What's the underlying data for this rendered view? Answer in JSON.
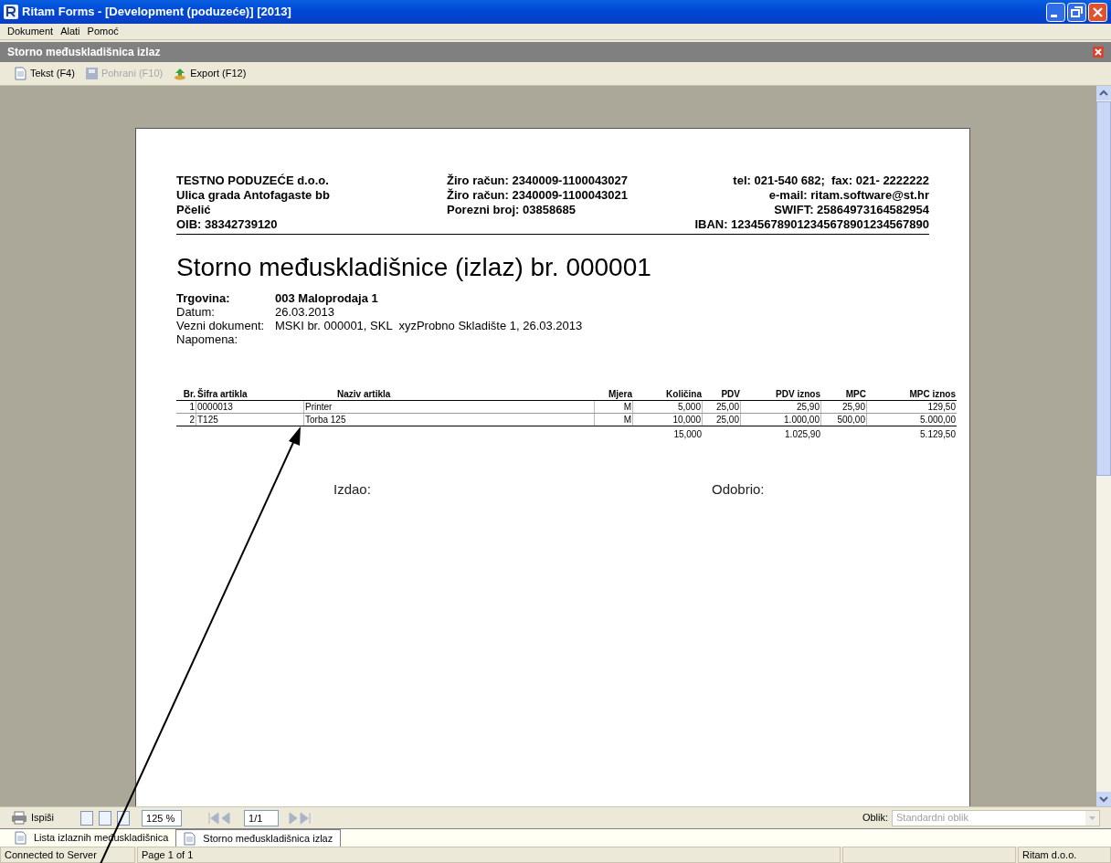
{
  "window": {
    "title": "Ritam Forms - [Development (poduzeće)] [2013]"
  },
  "menu": [
    "Dokument",
    "Alati",
    "Pomoć"
  ],
  "document_window": {
    "title": "Storno međuskladišnica izlaz"
  },
  "toolbar": [
    {
      "label": "Tekst (F4)",
      "disabled": false,
      "kind": "text"
    },
    {
      "label": "Pohrani (F10)",
      "disabled": true,
      "kind": "save"
    },
    {
      "label": "Export (F12)",
      "disabled": false,
      "kind": "export"
    }
  ],
  "report": {
    "company": [
      "TESTNO PODUZEĆE d.o.o.",
      "Ulica grada Antofagaste bb",
      "Pčelić",
      "OIB: 38342739120"
    ],
    "bank": [
      "Žiro račun: 2340009-1100043027",
      "Žiro račun: 2340009-1100043021",
      "Porezni broj: 03858685"
    ],
    "contact": [
      "tel: 021-540 682;  fax: 021- 2222222",
      "e-mail: ritam.software@st.hr",
      "SWIFT: 25864973164582954",
      "IBAN: 123456789012345678901234567890"
    ],
    "title": "Storno međuskladišnice (izlaz) br. 000001",
    "fields": [
      {
        "label": "Trgovina:",
        "value": "003 Maloprodaja 1",
        "bold": true
      },
      {
        "label": "Datum:",
        "value": "26.03.2013",
        "bold": false
      },
      {
        "label": "Vezni dokument:",
        "value": "MSKI br. 000001, SKL  xyzProbno Skladište 1, 26.03.2013",
        "bold": false
      },
      {
        "label": "Napomena:",
        "bold": false
      }
    ],
    "table": {
      "columns": [
        "Br.",
        "Šifra artikla",
        "Naziv artikla",
        "Mjera",
        "Količina",
        "PDV",
        "PDV iznos",
        "MPC",
        "MPC iznos"
      ],
      "rows": [
        [
          "1",
          "0000013",
          "Printer",
          "M",
          "5,000",
          "25,00",
          "25,90",
          "25,90",
          "129,50"
        ],
        [
          "2",
          "T125",
          "Torba 125",
          "M",
          "10,000",
          "25,00",
          "1.000,00",
          "500,00",
          "5.000,00"
        ]
      ],
      "totals": {
        "quantity": "15,000",
        "vat": "1.025,90",
        "amount": "5.129,50"
      }
    },
    "signatures": [
      "Izdao:",
      "Odobrio:"
    ]
  },
  "preview_toolbar": {
    "print": "Ispiši",
    "zoom": "125 %",
    "page": "1/1",
    "layout_label": "Oblik:",
    "layout_value": "Standardni oblik"
  },
  "tabs": [
    {
      "label": "Lista izlaznih međuskladišnica",
      "selected": false
    },
    {
      "label": "Storno međuskladišnica izlaz",
      "selected": true
    }
  ],
  "status_bar": [
    "Connected to Server",
    "Page 1 of 1",
    "Ritam d.o.o."
  ]
}
